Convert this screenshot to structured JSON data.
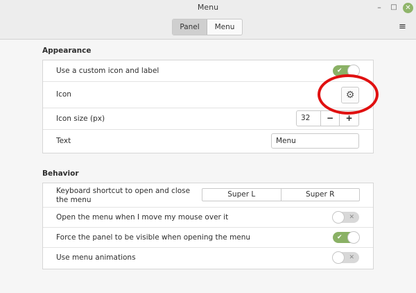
{
  "window": {
    "title": "Menu",
    "minimize_glyph": "–",
    "maximize_glyph": "□",
    "close_glyph": "✕",
    "menu_glyph": "≡"
  },
  "tabs": [
    {
      "label": "Panel",
      "active": true
    },
    {
      "label": "Menu",
      "active": false
    }
  ],
  "appearance": {
    "title": "Appearance",
    "custom_icon": {
      "label": "Use a custom icon and label",
      "on": true
    },
    "icon": {
      "label": "Icon",
      "icon_name": "gear-icon",
      "glyph": "⚙"
    },
    "icon_size": {
      "label": "Icon size (px)",
      "value": "32",
      "minus": "−",
      "plus": "+"
    },
    "text": {
      "label": "Text",
      "value": "Menu"
    }
  },
  "behavior": {
    "title": "Behavior",
    "shortcut": {
      "label": "Keyboard shortcut to open and close the menu",
      "key1": "Super L",
      "key2": "Super R"
    },
    "hover_open": {
      "label": "Open the menu when I move my mouse over it",
      "on": false
    },
    "force_panel": {
      "label": "Force the panel to be visible when opening the menu",
      "on": true
    },
    "animations": {
      "label": "Use menu animations",
      "on": false
    }
  },
  "switch_glyphs": {
    "on": "✔",
    "off": "✕"
  },
  "colors": {
    "accent": "#8ab165",
    "highlight": "#e01010",
    "close_button": "#8fb56a"
  }
}
